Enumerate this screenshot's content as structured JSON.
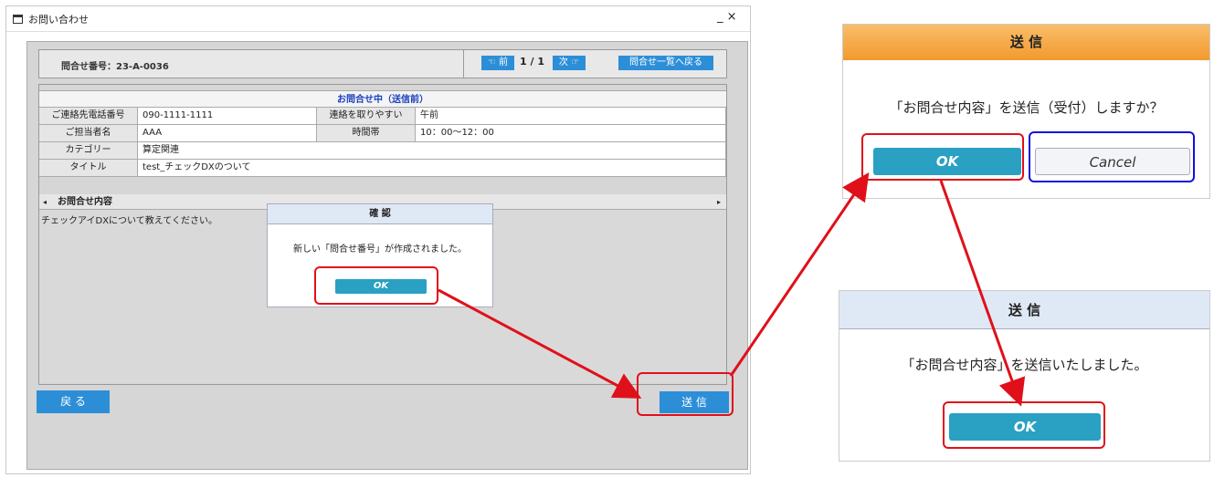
{
  "window": {
    "title": "お問い合わせ",
    "controls": "_ ×"
  },
  "toolbar": {
    "inquiry_number_label": "問合せ番号：23-A-0036",
    "prev_label": "☜ 前",
    "pager": "1 / 1",
    "next_label": "次 ☞",
    "back_to_list_label": "問合せ一覧へ戻る"
  },
  "form": {
    "status": "お問合せ中（送信前）",
    "phone_label": "ご連絡先電話番号",
    "phone_value": "090-1111-1111",
    "contact_time_label": "連絡を取りやすい",
    "contact_time_value": "午前",
    "person_label": "ご担当者名",
    "person_value": "AAA",
    "time_slot_label": "時間帯",
    "time_slot_value": "10：00～12：00",
    "category_label": "カテゴリー",
    "category_value": "算定関連",
    "title_label": "タイトル",
    "title_value": "test_チェックDXのついて",
    "content_label": "お問合せ内容",
    "content_value": "チェックアイDXについて教えてください。"
  },
  "buttons": {
    "back": "戻 る",
    "send": "送 信"
  },
  "confirm_dialog": {
    "title": "確 認",
    "message": "新しい「問合せ番号」が作成されました。",
    "ok": "OK"
  },
  "send_confirm_dialog": {
    "title": "送 信",
    "message": "「お問合せ内容」を送信（受付）しますか？",
    "ok": "OK",
    "cancel": "Cancel"
  },
  "send_done_dialog": {
    "title": "送 信",
    "message": "「お問合せ内容」を送信いたしました。",
    "ok": "OK"
  },
  "colors": {
    "accent_blue": "#2d8ed8",
    "ok_teal": "#2aa0c2",
    "highlight_red": "#e0101a",
    "cancel_outline": "#1010e0",
    "orange_header": "#f5a23a"
  }
}
